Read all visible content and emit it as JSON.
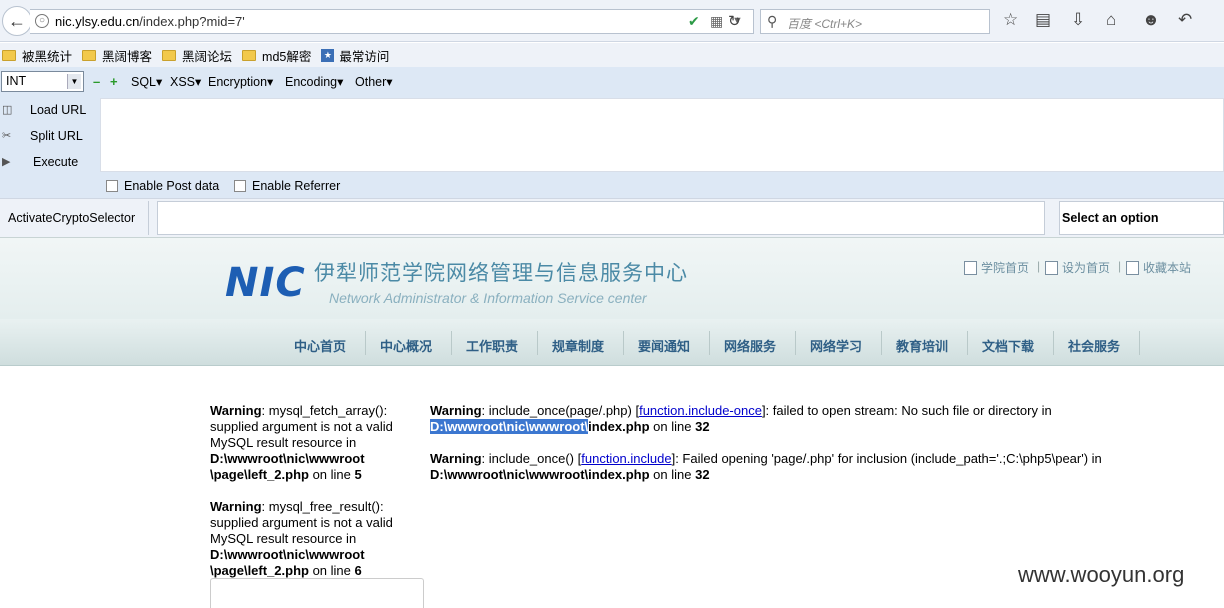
{
  "browser": {
    "url_host": "nic.ylsy.edu.cn",
    "url_path": "/index.php?mid=7'",
    "search_placeholder": "百度 <Ctrl+K>"
  },
  "bookmarks": [
    "被黑统计",
    "黑阔博客",
    "黑阔论坛",
    "md5解密",
    "最常访问"
  ],
  "hackbar": {
    "int_select": "INT",
    "menus": [
      "SQL▾",
      "XSS▾",
      "Encryption▾",
      "Encoding▾",
      "Other▾"
    ],
    "side_buttons": [
      "Load URL",
      "Split URL",
      "Execute"
    ],
    "checkboxes": [
      "Enable Post data",
      "Enable Referrer"
    ],
    "crypto_label": "ActivateCryptoSelector",
    "crypto_select": "Select an option"
  },
  "site": {
    "logo": "NIC",
    "title_cn": "伊犁师范学院网络管理与信息服务中心",
    "title_en": "Network Administrator & Information  Service center",
    "top_links": [
      "学院首页",
      "设为首页",
      "收藏本站"
    ],
    "nav": [
      "中心首页",
      "中心概况",
      "工作职责",
      "规章制度",
      "要闻通知",
      "网络服务",
      "网络学习",
      "教育培训",
      "文档下载",
      "社会服务"
    ]
  },
  "warnings": {
    "left1": {
      "label": "Warning",
      "l1": ": mysql_fetch_array():",
      "l2": "supplied argument is not a valid",
      "l3": "MySQL result resource in",
      "l4": "D:\\wwwroot\\nic\\wwwroot",
      "l5a": "\\page\\left_2.php",
      "l5b": " on line ",
      "line": "5"
    },
    "left2": {
      "label": "Warning",
      "l1": ": mysql_free_result():",
      "l2": "supplied argument is not a valid",
      "l3": "MySQL result resource in",
      "l4": "D:\\wwwroot\\nic\\wwwroot",
      "l5a": "\\page\\left_2.php",
      "l5b": " on line ",
      "line": "6"
    },
    "right1": {
      "label": "Warning",
      "l1a": ": include_once(page/.php) [",
      "link": "function.include-once",
      "l1b": "]: failed to open stream: No such file or directory in",
      "path_hl": "D:\\wwwroot\\nic\\wwwroot\\",
      "path_rest": "index.php",
      "l2b": " on line ",
      "line": "32"
    },
    "right2": {
      "label": "Warning",
      "l1a": ": include_once() [",
      "link": "function.include",
      "l1b": "]: Failed opening 'page/.php' for inclusion (include_path='.;C:\\php5\\pear') in",
      "path": "D:\\wwwroot\\nic\\wwwroot\\index.php",
      "l2b": " on line ",
      "line": "32"
    }
  },
  "watermark": "www.wooyun.org"
}
